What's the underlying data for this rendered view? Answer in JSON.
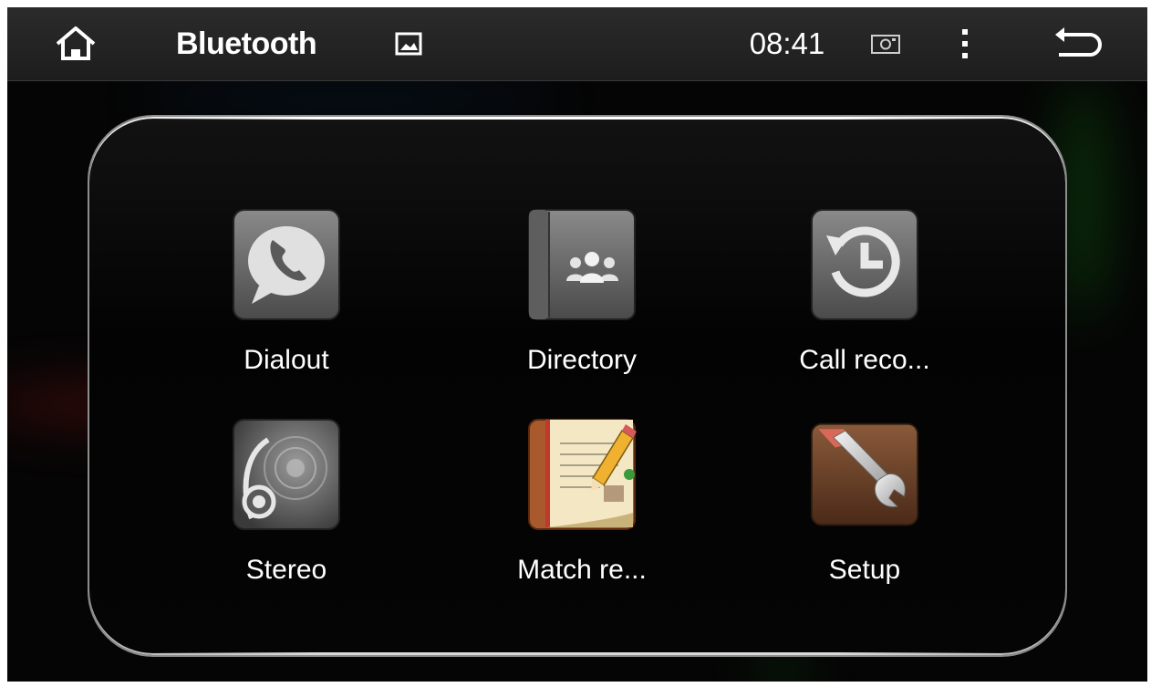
{
  "status_bar": {
    "title": "Bluetooth",
    "time": "08:41",
    "icons": [
      "home-icon",
      "image-icon",
      "screenshot-icon",
      "more-icon",
      "back-icon"
    ]
  },
  "apps": [
    {
      "label": "Dialout",
      "icon": "phone-bubble-icon"
    },
    {
      "label": "Directory",
      "icon": "contacts-book-icon"
    },
    {
      "label": "Call reco...",
      "icon": "call-history-icon"
    },
    {
      "label": "Stereo",
      "icon": "headphones-icon"
    },
    {
      "label": "Match re...",
      "icon": "notebook-pencil-icon"
    },
    {
      "label": "Setup",
      "icon": "wrench-icon"
    }
  ],
  "colors": {
    "background": "#050505",
    "status_bar": "#242424",
    "text": "#ffffff",
    "panel_border": "#d9d9d9"
  }
}
